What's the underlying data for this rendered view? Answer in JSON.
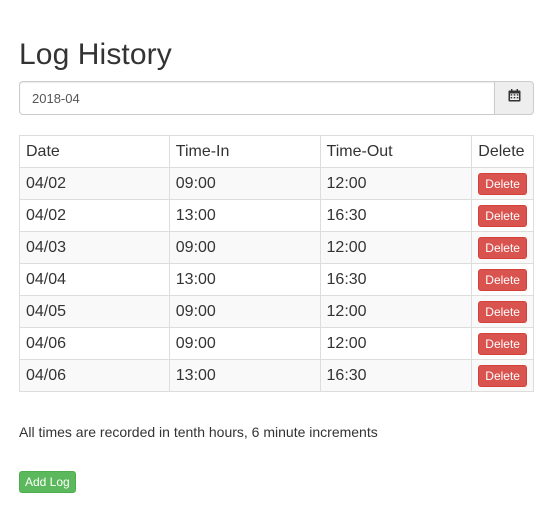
{
  "page": {
    "title": "Log History"
  },
  "date_picker": {
    "value": "2018-04",
    "icon": "calendar-icon"
  },
  "table": {
    "headers": {
      "date": "Date",
      "time_in": "Time-In",
      "time_out": "Time-Out",
      "delete": "Delete"
    },
    "rows": [
      {
        "date": "04/02",
        "time_in": "09:00",
        "time_out": "12:00",
        "delete_label": "Delete"
      },
      {
        "date": "04/02",
        "time_in": "13:00",
        "time_out": "16:30",
        "delete_label": "Delete"
      },
      {
        "date": "04/03",
        "time_in": "09:00",
        "time_out": "12:00",
        "delete_label": "Delete"
      },
      {
        "date": "04/04",
        "time_in": "13:00",
        "time_out": "16:30",
        "delete_label": "Delete"
      },
      {
        "date": "04/05",
        "time_in": "09:00",
        "time_out": "12:00",
        "delete_label": "Delete"
      },
      {
        "date": "04/06",
        "time_in": "09:00",
        "time_out": "12:00",
        "delete_label": "Delete"
      },
      {
        "date": "04/06",
        "time_in": "13:00",
        "time_out": "16:30",
        "delete_label": "Delete"
      }
    ]
  },
  "note": "All times are recorded in tenth hours, 6 minute increments",
  "add_button": {
    "label": "Add Log"
  },
  "colors": {
    "delete_button": "#d9534f",
    "add_button": "#5cb85c",
    "text": "#333333",
    "border": "#dddddd",
    "stripe": "#f9f9f9"
  }
}
